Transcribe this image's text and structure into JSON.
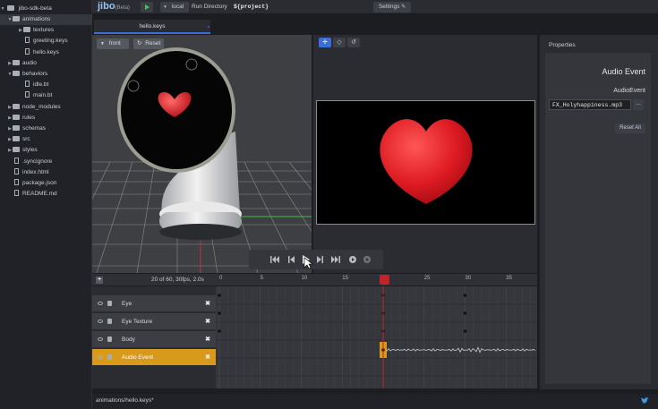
{
  "sidebar": {
    "root": "jibo-sdk-beta",
    "items": [
      {
        "label": "animations",
        "type": "folder",
        "expanded": true,
        "selected": true,
        "depth": 1
      },
      {
        "label": "textures",
        "type": "folder",
        "expanded": false,
        "depth": 2
      },
      {
        "label": "greeting.keys",
        "type": "file",
        "depth": 2
      },
      {
        "label": "hello.keys",
        "type": "file",
        "depth": 2
      },
      {
        "label": "audio",
        "type": "folder",
        "expanded": false,
        "depth": 1
      },
      {
        "label": "behaviors",
        "type": "folder",
        "expanded": true,
        "depth": 1
      },
      {
        "label": "idle.bt",
        "type": "file",
        "depth": 2
      },
      {
        "label": "main.bt",
        "type": "file",
        "depth": 2
      },
      {
        "label": "node_modules",
        "type": "folder",
        "expanded": false,
        "depth": 1
      },
      {
        "label": "rules",
        "type": "folder",
        "expanded": false,
        "depth": 1
      },
      {
        "label": "schemas",
        "type": "folder",
        "expanded": false,
        "depth": 1
      },
      {
        "label": "src",
        "type": "folder",
        "expanded": false,
        "depth": 1
      },
      {
        "label": "styles",
        "type": "folder",
        "expanded": false,
        "depth": 1
      },
      {
        "label": ".syncignore",
        "type": "file",
        "depth": 1
      },
      {
        "label": "index.html",
        "type": "file",
        "depth": 1
      },
      {
        "label": "package.json",
        "type": "file",
        "depth": 1
      },
      {
        "label": "README.md",
        "type": "file",
        "depth": 1
      }
    ]
  },
  "topbar": {
    "brand": "jibo",
    "brand_sub": "(Beta)",
    "target": "local",
    "run_dir_label": "Run Directory",
    "run_dir_value": "${project}",
    "settings_label": "Settings"
  },
  "tabs": [
    {
      "label": "hello.keys"
    }
  ],
  "viewport": {
    "view_label": "front",
    "reset_label": "Reset"
  },
  "timeline": {
    "frame_info": "20 of 60, 30fps, 2.0s",
    "ticks": [
      "0",
      "5",
      "10",
      "15",
      "20",
      "25",
      "30",
      "35"
    ],
    "playhead_frame": 20,
    "tracks": [
      {
        "label": "Eye",
        "active": false
      },
      {
        "label": "Eye Texture",
        "active": false
      },
      {
        "label": "Body",
        "active": false
      },
      {
        "label": "Audio Event",
        "active": true
      }
    ]
  },
  "properties": {
    "title": "Properties",
    "section_title": "Audio Event",
    "field_label": "AudioEvent",
    "field_value": "FX_Holyhappiness.mp3",
    "more_label": "...",
    "reset_all_label": "Reset All"
  },
  "status": {
    "path": "animations/hello.keys*"
  },
  "colors": {
    "accent_blue": "#3a6fd8",
    "track_active": "#d99a1c",
    "playhead": "#c0242a",
    "heart": "#e0242c"
  }
}
